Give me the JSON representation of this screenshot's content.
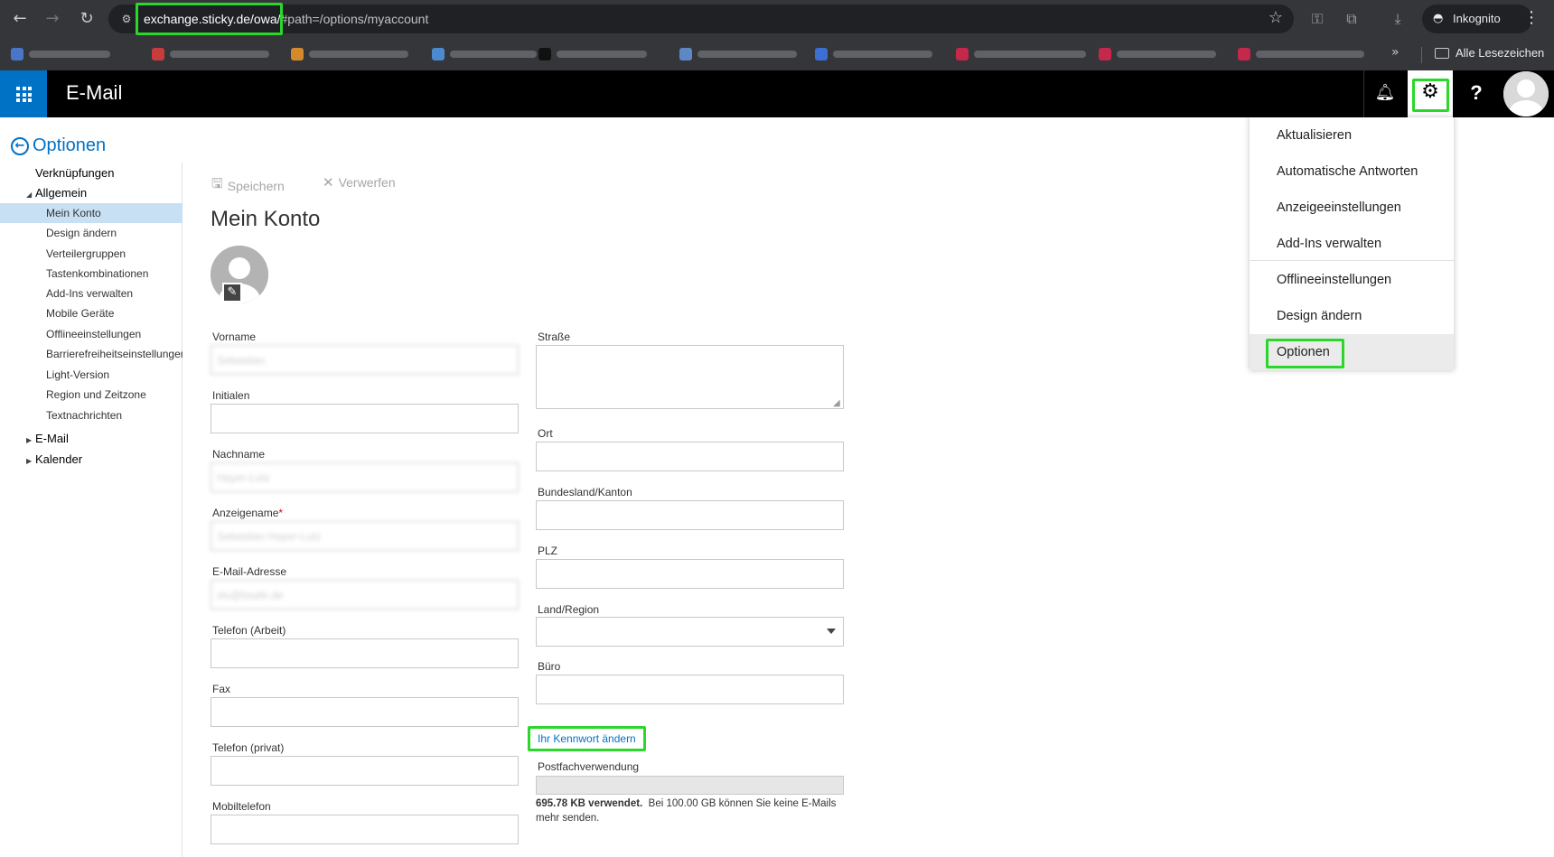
{
  "browser": {
    "url_host": "exchange.sticky.de/owa/",
    "url_path": "#path=/options/myaccount",
    "incognito_label": "Inkognito",
    "all_bookmarks_label": "Alle Lesezeichen"
  },
  "owa": {
    "app_title": "E-Mail",
    "back_label": "Optionen"
  },
  "nav": {
    "shortcuts": "Verknüpfungen",
    "general": "Allgemein",
    "items": [
      "Mein Konto",
      "Design ändern",
      "Verteilergruppen",
      "Tastenkombinationen",
      "Add-Ins verwalten",
      "Mobile Geräte",
      "Offlineeinstellungen",
      "Barrierefreiheitseinstellungen",
      "Light-Version",
      "Region und Zeitzone",
      "Textnachrichten"
    ],
    "email": "E-Mail",
    "calendar": "Kalender"
  },
  "toolbar": {
    "save_label": "Speichern",
    "discard_label": "Verwerfen"
  },
  "page": {
    "title": "Mein Konto"
  },
  "form": {
    "first_name_label": "Vorname",
    "first_name_value": "Sebastian",
    "initials_label": "Initialen",
    "last_name_label": "Nachname",
    "last_name_value": "Hayer-Lutz",
    "display_name_label": "Anzeigename",
    "display_name_required": "*",
    "display_name_value": "Sebastian Hayer-Lutz",
    "email_label": "E-Mail-Adresse",
    "email_value": "slu@bsafe.de",
    "phone_work_label": "Telefon (Arbeit)",
    "fax_label": "Fax",
    "phone_private_label": "Telefon (privat)",
    "mobile_label": "Mobiltelefon",
    "street_label": "Straße",
    "city_label": "Ort",
    "state_label": "Bundesland/Kanton",
    "zip_label": "PLZ",
    "country_label": "Land/Region",
    "office_label": "Büro",
    "change_password_link": "Ihr Kennwort ändern",
    "mailbox_usage_label": "Postfachverwendung",
    "quota_used": "695.78 KB verwendet.",
    "quota_note": "Bei 100.00 GB können Sie keine E-Mails mehr senden.",
    "quota_fraction": 6.6e-06
  },
  "settings_menu": {
    "items": [
      "Aktualisieren",
      "Automatische Antworten",
      "Anzeigeeinstellungen",
      "Add-Ins verwalten",
      "Offlineeinstellungen",
      "Design ändern",
      "Optionen"
    ]
  },
  "colors": {
    "accent": "#0072c6",
    "highlight_box": "#2bd72b",
    "top_bar": "#000000"
  }
}
